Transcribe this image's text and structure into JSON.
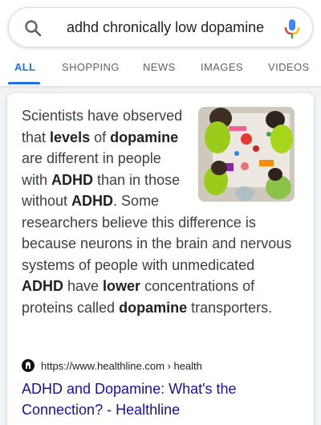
{
  "search": {
    "query": "adhd chronically low dopamine"
  },
  "tabs": [
    {
      "label": "ALL",
      "active": true
    },
    {
      "label": "SHOPPING",
      "active": false
    },
    {
      "label": "NEWS",
      "active": false
    },
    {
      "label": "IMAGES",
      "active": false
    },
    {
      "label": "VIDEOS",
      "active": false
    }
  ],
  "snippet": {
    "parts": [
      {
        "text": "Scientists have observed that ",
        "bold": false
      },
      {
        "text": "levels",
        "bold": true
      },
      {
        "text": " of ",
        "bold": false
      },
      {
        "text": "dopamine",
        "bold": true
      },
      {
        "text": " are different in people with ",
        "bold": false
      },
      {
        "text": "ADHD",
        "bold": true
      },
      {
        "text": " than in those without ",
        "bold": false
      },
      {
        "text": "ADHD",
        "bold": true
      },
      {
        "text": ". Some researchers believe this difference is because neurons in the brain and nervous systems of people with unmedicated ",
        "bold": false
      },
      {
        "text": "ADHD",
        "bold": true
      },
      {
        "text": " have ",
        "bold": false
      },
      {
        "text": "lower",
        "bold": true
      },
      {
        "text": " concentrations of proteins called ",
        "bold": false
      },
      {
        "text": "dopamine",
        "bold": true
      },
      {
        "text": " transporters.",
        "bold": false
      }
    ],
    "thumbnail_icon": "children-painting-photo"
  },
  "result": {
    "favicon_icon": "healthline-favicon",
    "source": "https://www.healthline.com › health",
    "title": "ADHD and Dopamine: What's the Connection? - Healthline"
  },
  "colors": {
    "accent": "#1a73e8",
    "link": "#1a0dab",
    "mic_blue": "#4285f4",
    "mic_red": "#ea4335",
    "mic_yellow": "#fbbc04",
    "mic_green": "#34a853"
  }
}
